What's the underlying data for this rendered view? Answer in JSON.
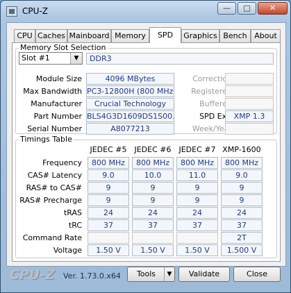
{
  "window": {
    "title": "CPU-Z",
    "min_label": "—",
    "max_label": "□",
    "close_label": "✕"
  },
  "tabs": [
    "CPU",
    "Caches",
    "Mainboard",
    "Memory",
    "SPD",
    "Graphics",
    "Bench",
    "About"
  ],
  "active_tab": "SPD",
  "slot": {
    "group_label": "Memory Slot Selection",
    "selected": "Slot #1",
    "type": "DDR3",
    "module_size_label": "Module Size",
    "module_size": "4096 MBytes",
    "max_bandwidth_label": "Max Bandwidth",
    "max_bandwidth": "PC3-12800H (800 MHz)",
    "manufacturer_label": "Manufacturer",
    "manufacturer": "Crucial Technology",
    "part_number_label": "Part Number",
    "part_number": "BLS4G3D1609DS1S00.",
    "serial_number_label": "Serial Number",
    "serial_number": "A8077213",
    "correction_label": "Correction",
    "registered_label": "Registered",
    "buffered_label": "Buffered",
    "spd_ext_label": "SPD Ext.",
    "spd_ext": "XMP 1.3",
    "week_year_label": "Week/Year"
  },
  "timings": {
    "group_label": "Timings Table",
    "columns": [
      "JEDEC #5",
      "JEDEC #6",
      "JEDEC #7",
      "XMP-1600"
    ],
    "rows": [
      {
        "label": "Frequency",
        "values": [
          "800 MHz",
          "800 MHz",
          "800 MHz",
          "800 MHz"
        ]
      },
      {
        "label": "CAS# Latency",
        "values": [
          "9.0",
          "10.0",
          "11.0",
          "9.0"
        ]
      },
      {
        "label": "RAS# to CAS#",
        "values": [
          "9",
          "9",
          "9",
          "9"
        ]
      },
      {
        "label": "RAS# Precharge",
        "values": [
          "9",
          "9",
          "9",
          "9"
        ]
      },
      {
        "label": "tRAS",
        "values": [
          "24",
          "24",
          "24",
          "24"
        ]
      },
      {
        "label": "tRC",
        "values": [
          "37",
          "37",
          "37",
          "37"
        ]
      },
      {
        "label": "Command Rate",
        "values": [
          "",
          "",
          "",
          "2T"
        ]
      },
      {
        "label": "Voltage",
        "values": [
          "1.50 V",
          "1.50 V",
          "1.50 V",
          "1.500 V"
        ]
      }
    ]
  },
  "footer": {
    "brand": "CPU-Z",
    "version": "Ver. 1.73.0.x64",
    "tools_label": "Tools",
    "validate_label": "Validate",
    "close_label": "Close"
  }
}
